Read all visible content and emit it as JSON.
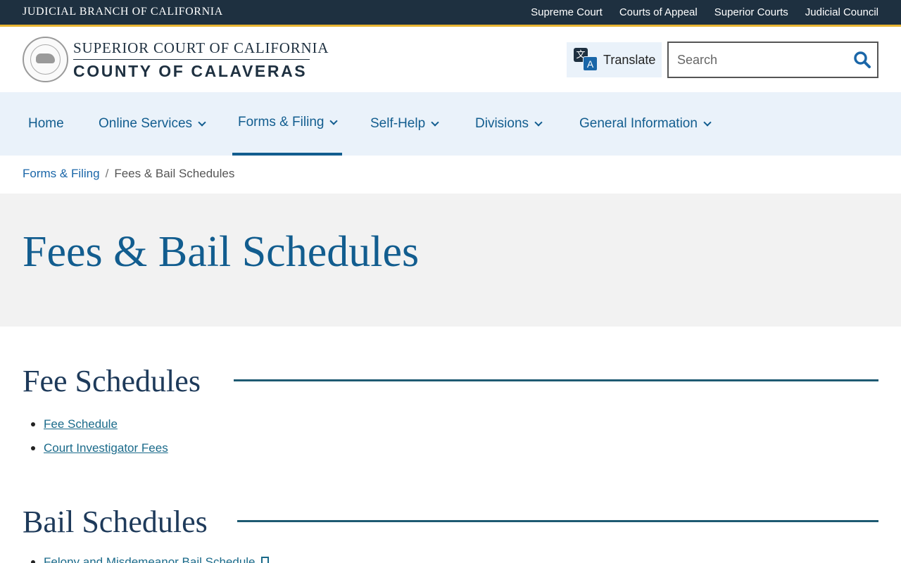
{
  "topbar": {
    "brand": "JUDICIAL BRANCH OF CALIFORNIA",
    "links": [
      "Supreme Court",
      "Courts of Appeal",
      "Superior Courts",
      "Judicial Council"
    ]
  },
  "header": {
    "logo_line1": "SUPERIOR COURT OF CALIFORNIA",
    "logo_line2": "COUNTY OF CALAVERAS",
    "translate_label": "Translate",
    "search_placeholder": "Search",
    "seal_icon": "california-seal-icon"
  },
  "nav": {
    "items": [
      {
        "label": "Home",
        "has_dropdown": false
      },
      {
        "label": "Online Services",
        "has_dropdown": true
      },
      {
        "label": "Forms & Filing",
        "has_dropdown": true,
        "active": true
      },
      {
        "label": "Self-Help",
        "has_dropdown": true
      },
      {
        "label": "Divisions",
        "has_dropdown": true
      },
      {
        "label": "General Information",
        "has_dropdown": true
      }
    ]
  },
  "breadcrumb": {
    "parent": "Forms & Filing",
    "separator": "/",
    "current": "Fees & Bail Schedules"
  },
  "page": {
    "title": "Fees & Bail Schedules"
  },
  "sections": [
    {
      "title": "Fee Schedules",
      "links": [
        "Fee Schedule",
        "Court Investigator Fees"
      ]
    },
    {
      "title": "Bail Schedules",
      "links": [
        "Felony and Misdemeanor Bail Schedule"
      ]
    }
  ],
  "colors": {
    "topbar_bg": "#1e3040",
    "topbar_accent": "#e8b431",
    "nav_bg": "#eaf2fa",
    "link_blue": "#125d8f",
    "hero_bg": "#f2f2f2",
    "section_rule": "#1e5a72"
  }
}
